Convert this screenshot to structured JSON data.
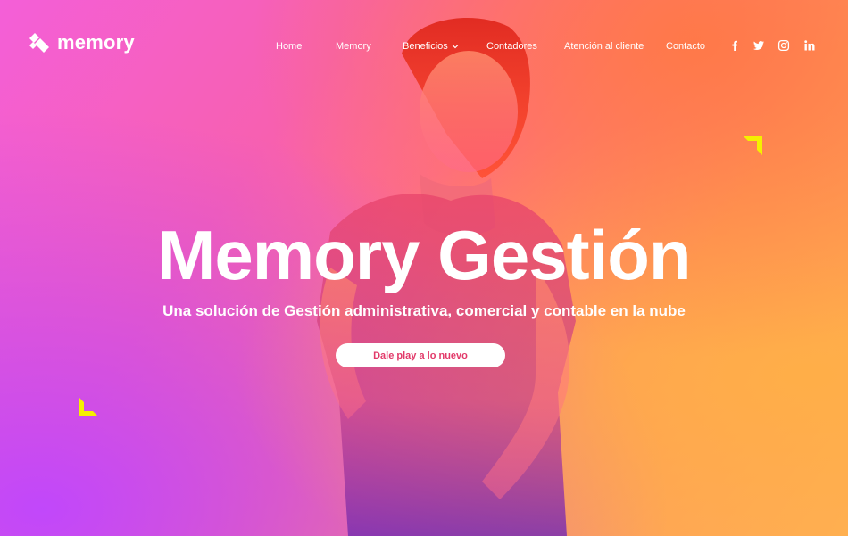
{
  "brand": {
    "name": "memory"
  },
  "nav": {
    "items": [
      {
        "label": "Home"
      },
      {
        "label": "Memory"
      },
      {
        "label": "Beneficios"
      },
      {
        "label": "Contadores"
      },
      {
        "label": "Atención al cliente"
      },
      {
        "label": "Contacto"
      }
    ]
  },
  "social": [
    "facebook-icon",
    "twitter-icon",
    "instagram-icon",
    "linkedin-icon"
  ],
  "hero": {
    "title": "Memory Gestión",
    "subtitle": "Una solución de Gestión administrativa, comercial y contable en la nube",
    "cta_label": "Dale play a lo nuevo"
  },
  "colors": {
    "accent_yellow": "#f5f000",
    "cta_text": "#e23a6a",
    "text": "#ffffff"
  }
}
